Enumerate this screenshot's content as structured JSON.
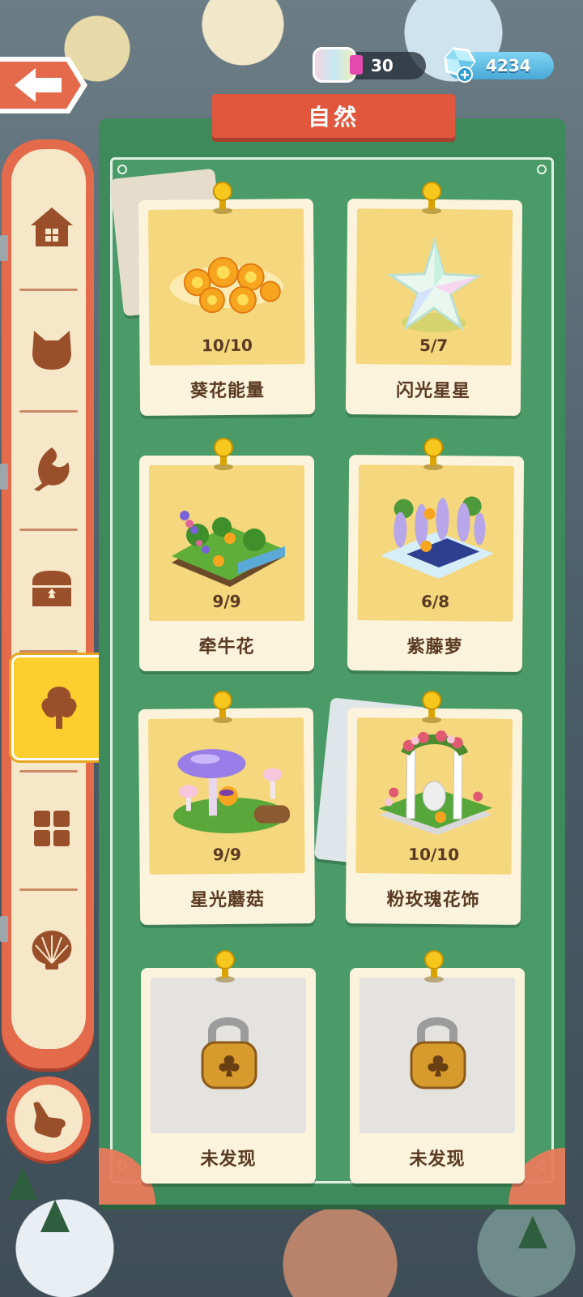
{
  "currencies": {
    "rainbow": {
      "value": "30",
      "icon": "rainbow-cloud-icon"
    },
    "diamond": {
      "value": "4234",
      "icon": "diamond-plus-icon"
    }
  },
  "panel": {
    "title": "自然"
  },
  "side_tabs": [
    {
      "name": "house",
      "icon": "house-icon",
      "active": false
    },
    {
      "name": "cat",
      "icon": "cat-head-icon",
      "active": false
    },
    {
      "name": "leaf",
      "icon": "leaf-icon",
      "active": false
    },
    {
      "name": "chest",
      "icon": "treasure-chest-icon",
      "active": false
    },
    {
      "name": "nature",
      "icon": "tree-icon",
      "active": true
    },
    {
      "name": "grid",
      "icon": "grid-icon",
      "active": false
    },
    {
      "name": "shell",
      "icon": "shell-icon",
      "active": false
    }
  ],
  "cards": [
    {
      "name": "葵花能量",
      "count": "10/10",
      "locked": false
    },
    {
      "name": "闪光星星",
      "count": "5/7",
      "locked": false
    },
    {
      "name": "牵牛花",
      "count": "9/9",
      "locked": false
    },
    {
      "name": "紫藤萝",
      "count": "6/8",
      "locked": false
    },
    {
      "name": "星光蘑菇",
      "count": "9/9",
      "locked": false
    },
    {
      "name": "粉玫瑰花饰",
      "count": "10/10",
      "locked": false
    },
    {
      "name": "未发现",
      "count": "",
      "locked": true
    },
    {
      "name": "未发现",
      "count": "",
      "locked": true
    }
  ],
  "colors": {
    "accent": "#e0573e",
    "panel": "#3f8a5a",
    "active_tab": "#fdcf2e",
    "card_art": "#f5d77e"
  }
}
